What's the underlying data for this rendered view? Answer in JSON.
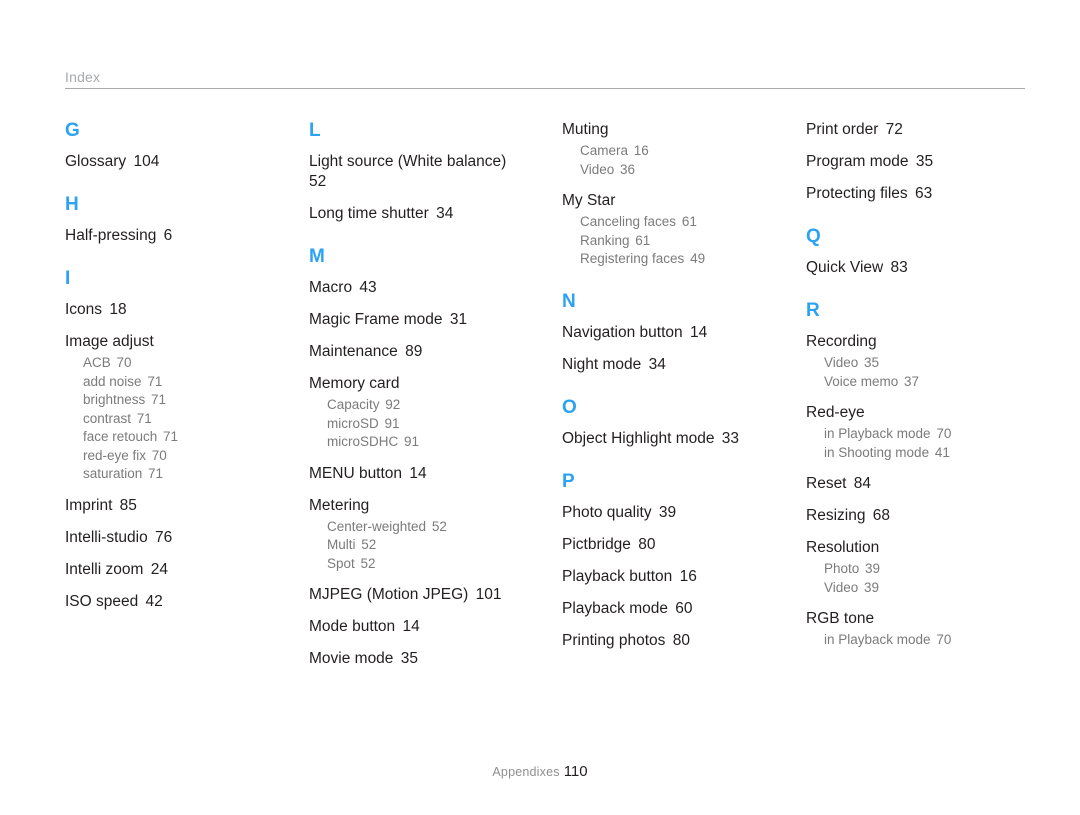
{
  "header": {
    "title": "Index"
  },
  "footer": {
    "label": "Appendixes",
    "page": "110"
  },
  "theme": {
    "accent": "#2ba3f2",
    "text": "#231f20",
    "sub_text": "#7b7b7b",
    "rule": "#a7a9ac",
    "header_text": "#a7a9ac",
    "background": "#ffffff"
  },
  "columns": [
    {
      "id": "column-1",
      "blocks": [
        {
          "type": "letter",
          "label": "G"
        },
        {
          "type": "entry",
          "label": "Glossary",
          "page": "104"
        },
        {
          "type": "letter",
          "label": "H"
        },
        {
          "type": "entry",
          "label": "Half-pressing",
          "page": "6"
        },
        {
          "type": "letter",
          "label": "I"
        },
        {
          "type": "entry",
          "label": "Icons",
          "page": "18"
        },
        {
          "type": "entry",
          "label": "Image adjust",
          "page": "",
          "subs": [
            {
              "label": "ACB",
              "page": "70"
            },
            {
              "label": "add noise",
              "page": "71"
            },
            {
              "label": "brightness",
              "page": "71"
            },
            {
              "label": "contrast",
              "page": "71"
            },
            {
              "label": "face retouch",
              "page": "71"
            },
            {
              "label": "red-eye fix",
              "page": "70"
            },
            {
              "label": "saturation",
              "page": "71"
            }
          ]
        },
        {
          "type": "entry",
          "label": "Imprint",
          "page": "85"
        },
        {
          "type": "entry",
          "label": "Intelli-studio",
          "page": "76"
        },
        {
          "type": "entry",
          "label": "Intelli zoom",
          "page": "24"
        },
        {
          "type": "entry",
          "label": "ISO speed",
          "page": "42"
        }
      ]
    },
    {
      "id": "column-2",
      "blocks": [
        {
          "type": "letter",
          "label": "L"
        },
        {
          "type": "entry",
          "label": "Light source (White balance)",
          "page": "52"
        },
        {
          "type": "entry",
          "label": "Long time shutter",
          "page": "34"
        },
        {
          "type": "letter",
          "label": "M"
        },
        {
          "type": "entry",
          "label": "Macro",
          "page": "43"
        },
        {
          "type": "entry",
          "label": "Magic Frame mode",
          "page": "31"
        },
        {
          "type": "entry",
          "label": "Maintenance",
          "page": "89"
        },
        {
          "type": "entry",
          "label": "Memory card",
          "page": "",
          "subs": [
            {
              "label": "Capacity",
              "page": "92"
            },
            {
              "label": "microSD",
              "page": "91"
            },
            {
              "label": "microSDHC",
              "page": "91"
            }
          ]
        },
        {
          "type": "entry",
          "label": "MENU button",
          "page": "14"
        },
        {
          "type": "entry",
          "label": "Metering",
          "page": "",
          "subs": [
            {
              "label": "Center-weighted",
              "page": "52"
            },
            {
              "label": "Multi",
              "page": "52"
            },
            {
              "label": "Spot",
              "page": "52"
            }
          ]
        },
        {
          "type": "entry",
          "label": "MJPEG (Motion JPEG)",
          "page": "101"
        },
        {
          "type": "entry",
          "label": "Mode button",
          "page": "14"
        },
        {
          "type": "entry",
          "label": "Movie mode",
          "page": "35"
        }
      ]
    },
    {
      "id": "column-3",
      "blocks": [
        {
          "type": "entry",
          "label": "Muting",
          "page": "",
          "subs": [
            {
              "label": "Camera",
              "page": "16"
            },
            {
              "label": "Video",
              "page": "36"
            }
          ]
        },
        {
          "type": "entry",
          "label": "My Star",
          "page": "",
          "subs": [
            {
              "label": "Canceling faces",
              "page": "61"
            },
            {
              "label": "Ranking",
              "page": "61"
            },
            {
              "label": "Registering faces",
              "page": "49"
            }
          ]
        },
        {
          "type": "letter",
          "label": "N"
        },
        {
          "type": "entry",
          "label": "Navigation button",
          "page": "14"
        },
        {
          "type": "entry",
          "label": "Night mode",
          "page": "34"
        },
        {
          "type": "letter",
          "label": "O"
        },
        {
          "type": "entry",
          "label": "Object Highlight mode",
          "page": "33"
        },
        {
          "type": "letter",
          "label": "P"
        },
        {
          "type": "entry",
          "label": "Photo quality",
          "page": "39"
        },
        {
          "type": "entry",
          "label": "Pictbridge",
          "page": "80"
        },
        {
          "type": "entry",
          "label": "Playback button",
          "page": "16"
        },
        {
          "type": "entry",
          "label": "Playback mode",
          "page": "60"
        },
        {
          "type": "entry",
          "label": "Printing photos",
          "page": "80"
        }
      ]
    },
    {
      "id": "column-4",
      "blocks": [
        {
          "type": "entry",
          "label": "Print order",
          "page": "72"
        },
        {
          "type": "entry",
          "label": "Program mode",
          "page": "35"
        },
        {
          "type": "entry",
          "label": "Protecting files",
          "page": "63"
        },
        {
          "type": "letter",
          "label": "Q"
        },
        {
          "type": "entry",
          "label": "Quick View",
          "page": "83"
        },
        {
          "type": "letter",
          "label": "R"
        },
        {
          "type": "entry",
          "label": "Recording",
          "page": "",
          "subs": [
            {
              "label": "Video",
              "page": "35"
            },
            {
              "label": "Voice memo",
              "page": "37"
            }
          ]
        },
        {
          "type": "entry",
          "label": "Red-eye",
          "page": "",
          "subs": [
            {
              "label": "in Playback mode",
              "page": "70"
            },
            {
              "label": "in Shooting mode",
              "page": "41"
            }
          ]
        },
        {
          "type": "entry",
          "label": "Reset",
          "page": "84"
        },
        {
          "type": "entry",
          "label": "Resizing",
          "page": "68"
        },
        {
          "type": "entry",
          "label": "Resolution",
          "page": "",
          "subs": [
            {
              "label": "Photo",
              "page": "39"
            },
            {
              "label": "Video",
              "page": "39"
            }
          ]
        },
        {
          "type": "entry",
          "label": "RGB tone",
          "page": "",
          "subs": [
            {
              "label": "in Playback mode",
              "page": "70"
            }
          ]
        }
      ]
    }
  ]
}
